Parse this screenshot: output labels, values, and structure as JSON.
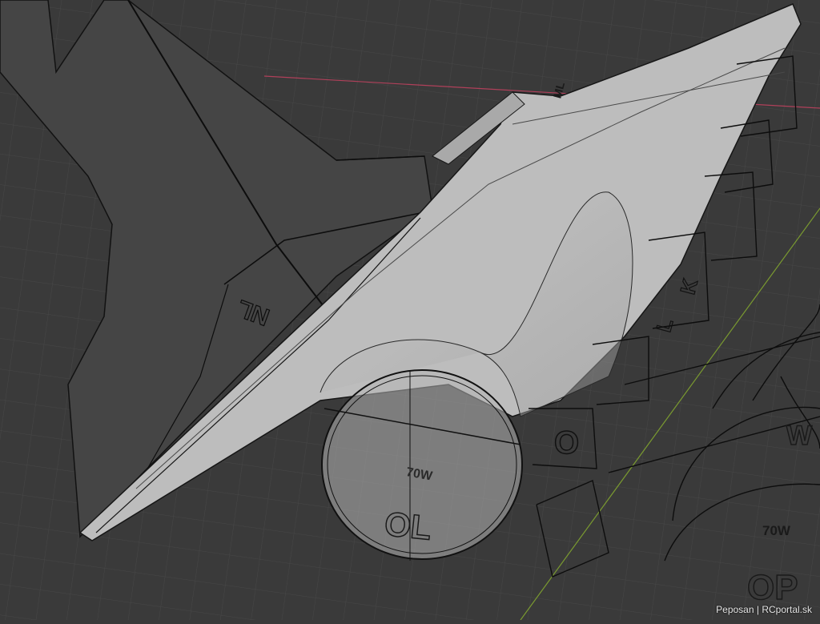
{
  "viewport": {
    "background_color": "#3a3a3a",
    "grid_color": "#474747",
    "axis_x_color": "#b0405a",
    "axis_y_color": "#7a9a30",
    "wing_color": "#bdbdbd",
    "tail_color": "#454545",
    "outline_color": "#0d0d0d"
  },
  "part_labels": {
    "tail": "NL",
    "intake_frame": "70W",
    "intake_duct": "OL",
    "side_frame": "O",
    "right_frame": "70W",
    "right_part": "OP",
    "right_w": "W",
    "former_k": "K",
    "former_l": "L",
    "top_mark": "ML"
  },
  "watermark": "Peposan | RCportal.sk",
  "icons": [
    "grid-floor-icon",
    "x-axis-icon",
    "y-axis-icon"
  ]
}
